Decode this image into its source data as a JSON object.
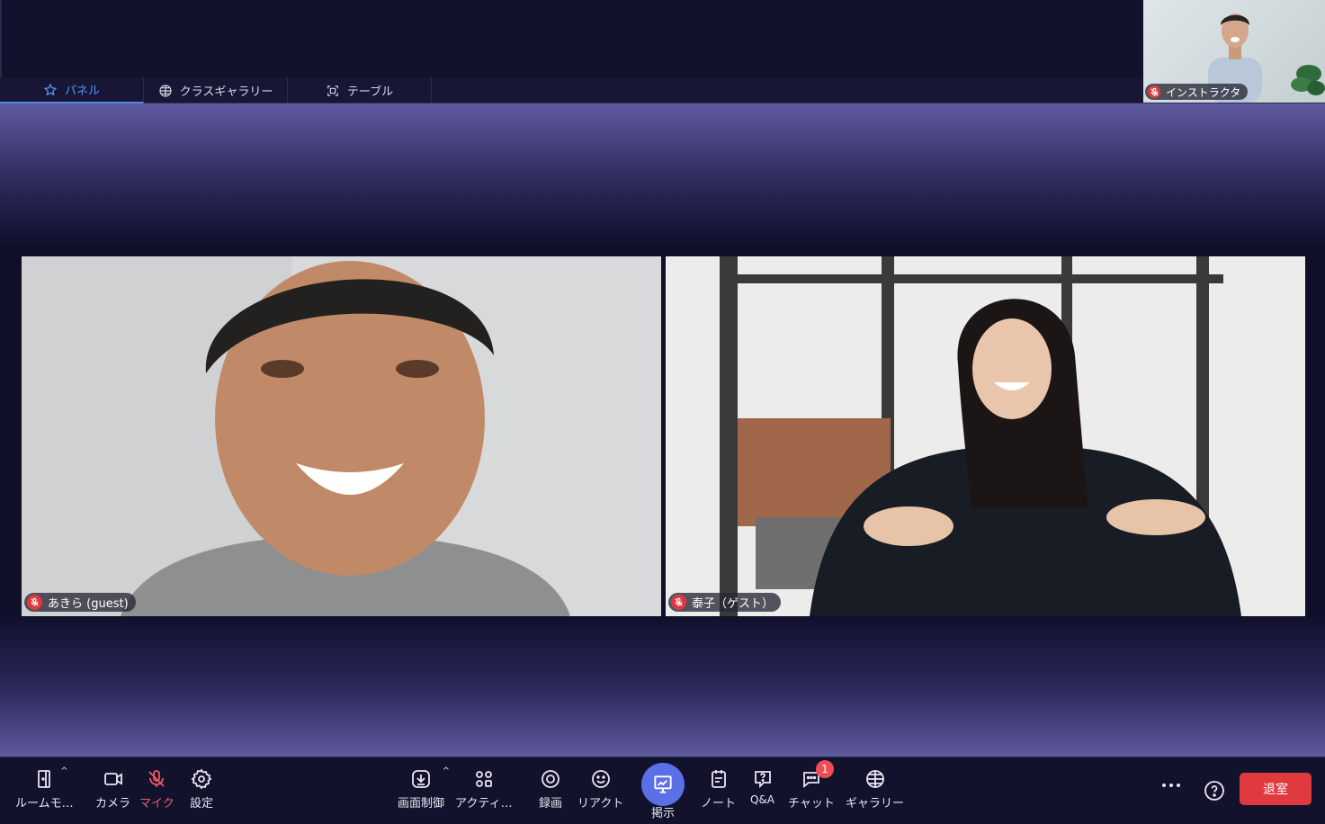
{
  "tabs": [
    {
      "label": "パネル",
      "icon": "star-icon",
      "active": true
    },
    {
      "label": "クラスギャラリー",
      "icon": "grid-globe-icon",
      "active": false
    },
    {
      "label": "テーブル",
      "icon": "frame-icon",
      "active": false
    }
  ],
  "pip": {
    "name": "インストラクタ"
  },
  "tiles": [
    {
      "name": "あきら (guest)"
    },
    {
      "name": "泰子（ゲスト）"
    }
  ],
  "toolbar": {
    "room_mode": "ルームモ…",
    "camera": "カメラ",
    "mic": "マイク",
    "settings": "設定",
    "screen_control": "画面制御",
    "activity": "アクティ…",
    "record": "録画",
    "react": "リアクト",
    "present": "掲示",
    "note": "ノート",
    "qa": "Q&A",
    "chat": "チャット",
    "chat_badge": "1",
    "gallery": "ギャラリー",
    "leave": "退室"
  },
  "colors": {
    "accent": "#5b8ff9",
    "present": "#5b6fe6",
    "danger": "#e03a3e",
    "muted_mic": "#f05b66"
  }
}
